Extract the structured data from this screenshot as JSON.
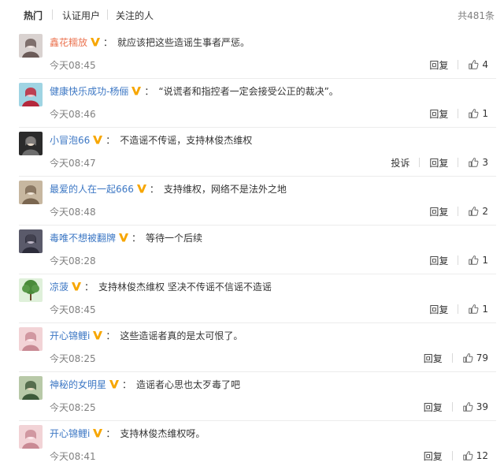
{
  "tabs": [
    {
      "label": "热门",
      "active": true
    },
    {
      "label": "认证用户",
      "active": false
    },
    {
      "label": "关注的人",
      "active": false
    }
  ],
  "total": "共481条",
  "actions": {
    "reply": "回复",
    "report": "投诉"
  },
  "colors": {
    "username_accent": "#eb7350",
    "username_link": "#3c77c4",
    "v_badge": "#f7a600",
    "muted": "#808080"
  },
  "comments": [
    {
      "username": "鑫花糯放",
      "badge": "v-badge-icon",
      "text": "就应该把这些造谣生事者严惩。",
      "time": "今天08:45",
      "likes": "4",
      "report": false
    },
    {
      "username": "健康快乐成功-杨俪",
      "badge": "v-badge-icon",
      "text": "“说谎者和指控者一定会接受公正的裁决”。",
      "time": "今天08:46",
      "likes": "1",
      "report": false
    },
    {
      "username": "小冒泡66",
      "badge": "v-badge-icon",
      "text": "不造谣不传谣，支持林俊杰维权",
      "time": "今天08:47",
      "likes": "3",
      "report": true
    },
    {
      "username": "最爱的人在一起666",
      "badge": "v-badge-icon",
      "text": "支持维权，网络不是法外之地",
      "time": "今天08:48",
      "likes": "2",
      "report": false
    },
    {
      "username": "毒唯不想被翻牌",
      "badge": "v-badge-icon",
      "text": "等待一个后续",
      "time": "今天08:28",
      "likes": "1",
      "report": false
    },
    {
      "username": "凉菠",
      "badge": "v-badge-icon",
      "text": "支持林俊杰维权 坚决不传谣不信谣不造谣",
      "time": "今天08:45",
      "likes": "1",
      "report": false
    },
    {
      "username": "开心锦鲤i",
      "badge": "v-badge-icon",
      "text": "这些造谣者真的是太可恨了。",
      "time": "今天08:25",
      "likes": "79",
      "report": false
    },
    {
      "username": "神秘的女明星",
      "badge": "v-badge-icon",
      "text": "造谣者心思也太歹毒了吧",
      "time": "今天08:25",
      "likes": "39",
      "report": false
    },
    {
      "username": "开心锦鲤i",
      "badge": "v-badge-icon",
      "text": "支持林俊杰维权呀。",
      "time": "今天08:41",
      "likes": "12",
      "report": false
    }
  ]
}
